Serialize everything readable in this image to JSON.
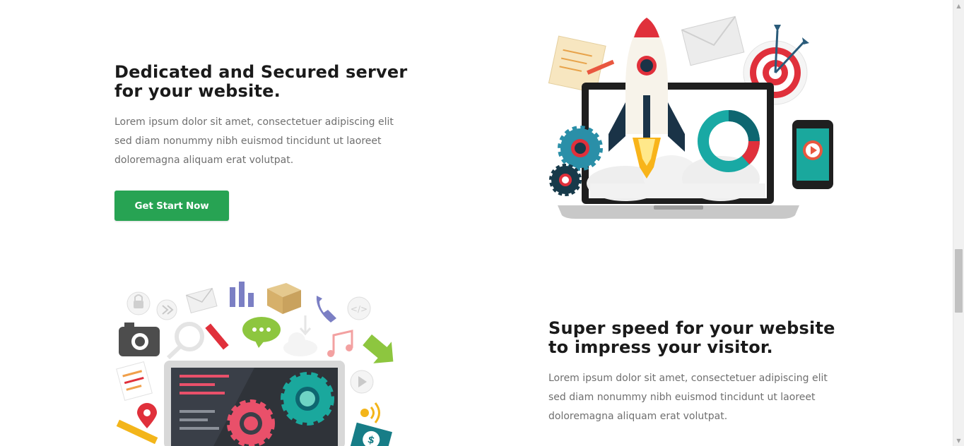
{
  "feature1": {
    "title_line1": "Dedicated and Secured server",
    "title_line2": "for your website.",
    "desc_line1": "Lorem ipsum dolor sit amet, consectetuer adipiscing elit",
    "desc_line2": "sed diam nonummy nibh euismod tincidunt ut laoreet",
    "desc_line3": "doloremagna aliquam erat volutpat.",
    "button_label": "Get Start Now",
    "illustration_icon": "rocket-laptop-illustration"
  },
  "feature2": {
    "title_line1": "Super speed for your website",
    "title_line2": "to impress your visitor.",
    "desc_line1": "Lorem ipsum dolor sit amet, consectetuer adipiscing elit",
    "desc_line2": "sed diam nonummy nibh euismod tincidunt ut laoreet",
    "desc_line3": "doloremagna aliquam erat volutpat.",
    "illustration_icon": "laptop-icons-illustration"
  },
  "colors": {
    "button_green": "#27a353",
    "heading": "#1a1a1a",
    "body_text": "#6f6f6f"
  }
}
